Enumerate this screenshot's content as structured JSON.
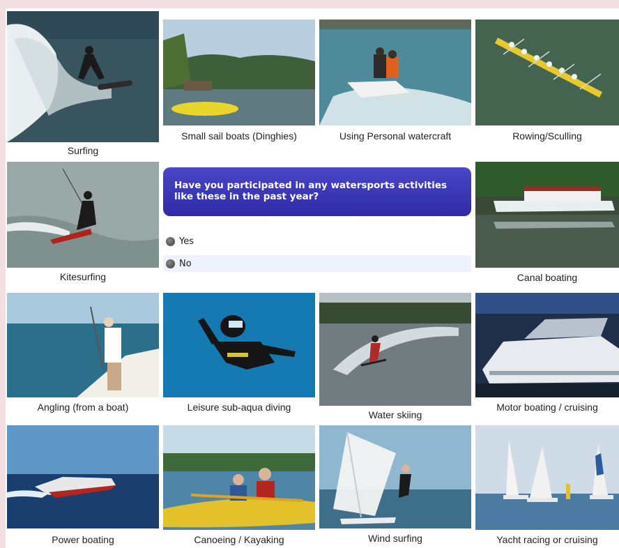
{
  "question": {
    "text": "Have you participated in any watersports activities like these in the past year?",
    "options": [
      "Yes",
      "No"
    ]
  },
  "activities": [
    {
      "label": "Surfing",
      "icon": "surfing-photo"
    },
    {
      "label": "Small sail boats (Dinghies)",
      "icon": "dinghy-photo"
    },
    {
      "label": "Using Personal watercraft",
      "icon": "jetski-photo"
    },
    {
      "label": "Rowing/Sculling",
      "icon": "rowing-photo"
    },
    {
      "label": "Kitesurfing",
      "icon": "kitesurfing-photo"
    },
    {
      "label": "Canal boating",
      "icon": "canal-boat-photo"
    },
    {
      "label": "Angling (from a boat)",
      "icon": "angling-photo"
    },
    {
      "label": "Leisure sub-aqua diving",
      "icon": "diving-photo"
    },
    {
      "label": "Water skiing",
      "icon": "water-skiing-photo"
    },
    {
      "label": "Motor boating / cruising",
      "icon": "motor-boat-photo"
    },
    {
      "label": "Power boating",
      "icon": "power-boat-photo"
    },
    {
      "label": "Canoeing / Kayaking",
      "icon": "kayak-photo"
    },
    {
      "label": "Wind surfing",
      "icon": "windsurf-photo"
    },
    {
      "label": "Yacht racing or cruising",
      "icon": "yacht-photo"
    }
  ],
  "colors": {
    "page_bg": "#f3dfe2",
    "question_bg": "#3b38b8",
    "question_text": "#ffffff",
    "option_alt_bg": "#eef2fb"
  }
}
